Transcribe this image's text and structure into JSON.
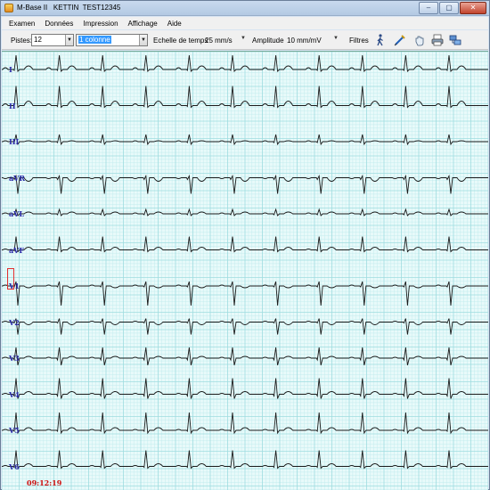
{
  "window": {
    "title": "M-Base II   KETTIN  TEST12345",
    "minimize_icon": "minimize-icon",
    "maximize_icon": "maximize-icon",
    "close_icon": "close-icon"
  },
  "menu": [
    "Examen",
    "Données",
    "Impression",
    "Affichage",
    "Aide"
  ],
  "toolbar": {
    "pistes_label": "Pistes:",
    "pistes_value": "12",
    "layout_value": "1 colonne",
    "echelle_label": "Echelle de temps",
    "echelle_value": "25 mm/s",
    "amplitude_label": "Amplitude",
    "amplitude_value": "10 mm/mV",
    "filtres_label": "Filtres",
    "icons": [
      "walking-person-icon",
      "measure-pen-icon",
      "hand-icon",
      "print-icon",
      "network-icon"
    ]
  },
  "ecg": {
    "leads": [
      "I",
      "II",
      "III",
      "aVR",
      "aVL",
      "aVF",
      "V1",
      "V2",
      "V3",
      "V4",
      "V5",
      "V6"
    ],
    "time": "09:12:19",
    "grid_color": "#9fdde0",
    "background": "#e8fafa",
    "trace_color": "#1a1a1a",
    "label_color": "#2a2aa8"
  }
}
